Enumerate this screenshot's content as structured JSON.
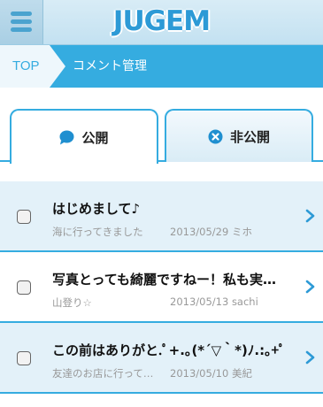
{
  "header": {
    "logo": "JUGEM"
  },
  "breadcrumb": {
    "top": "TOP",
    "current": "コメント管理"
  },
  "tabs": [
    {
      "label": "公開",
      "icon": "speech-bubble-icon",
      "active": true
    },
    {
      "label": "非公開",
      "icon": "x-circle-icon",
      "active": false
    }
  ],
  "comments": [
    {
      "title": "はじめまして♪",
      "subtitle": "海に行ってきました",
      "date": "2013/05/29",
      "author": "ミホ",
      "date_author": "2013/05/29 ミホ"
    },
    {
      "title": "写真とっても綺麗ですねー！私も実…",
      "subtitle": "山登り☆",
      "date": "2013/05/13",
      "author": "sachi",
      "date_author": "2013/05/13 sachi"
    },
    {
      "title": "この前はありがと.ﾟ+.｡(*´▽｀*)ﾉ.:｡+ﾟ",
      "subtitle": "友達のお店に行って…",
      "date": "2013/05/10",
      "author": "美紀",
      "date_author": "2013/05/10 美紀"
    }
  ],
  "colors": {
    "accent": "#35ace0",
    "row_alt": "#e3f1f9",
    "text_gray": "#999999"
  }
}
